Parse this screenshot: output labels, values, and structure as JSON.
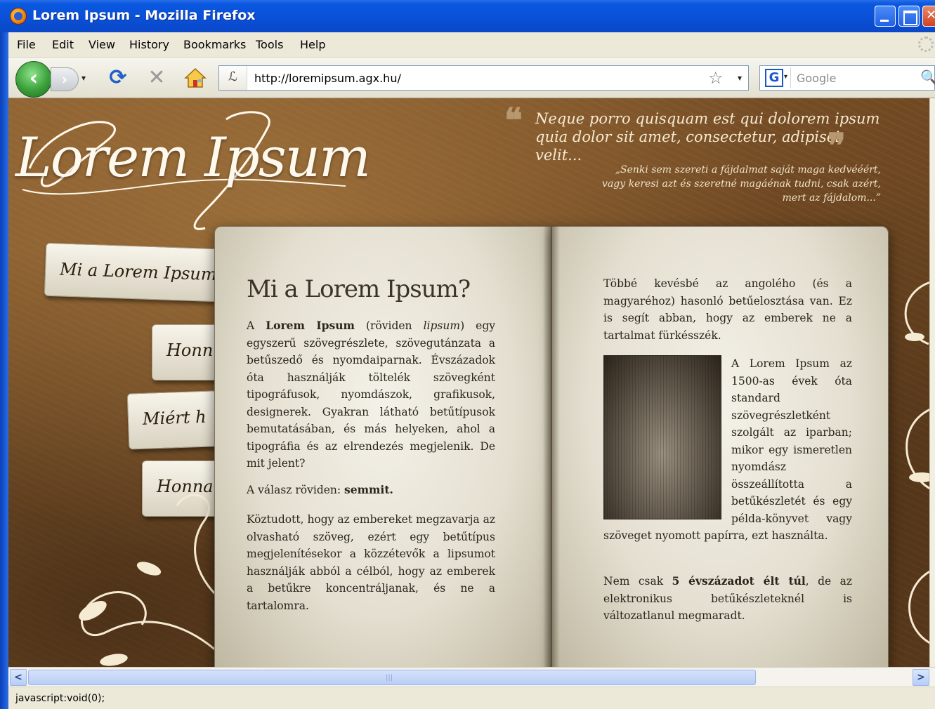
{
  "window": {
    "title": "Lorem Ipsum - Mozilla Firefox"
  },
  "menu": [
    "File",
    "Edit",
    "View",
    "History",
    "Bookmarks",
    "Tools",
    "Help"
  ],
  "nav": {
    "back_glyph": "‹",
    "forward_glyph": "›",
    "dropdown_glyph": "▾",
    "reload_glyph": "⟳",
    "stop_glyph": "✕",
    "home_icon": "home-icon"
  },
  "url": {
    "icon_glyph": "ℒ",
    "value": "http://loremipsum.agx.hu/",
    "star_glyph": "☆",
    "dropdown_glyph": "▾"
  },
  "search": {
    "engine_glyph": "G",
    "placeholder": "Google",
    "go_glyph": "🔍"
  },
  "page": {
    "logo": "Lorem Ipsum",
    "quote_main": "Neque porro quisquam est qui dolorem ipsum quia dolor sit amet, consectetur, adipisci velit...",
    "quote_open": "❝",
    "quote_close": "❞",
    "quote_sub": "„Senki sem szereti a fájdalmat saját maga kedvééért, vagy keresi azt és szeretné magáénak tudni, csak azért, mert az fájdalom...”",
    "nav_items": [
      "Mi a Lorem Ipsum",
      "Honn",
      "Miért h",
      "Honna"
    ],
    "left": {
      "title": "Mi a Lorem Ipsum?",
      "p1_a": "A ",
      "p1_bold": "Lorem Ipsum",
      "p1_b": " (röviden ",
      "p1_italic": "lipsum",
      "p1_c": ") egy egyszerű szövegrészlete, szövegutánzata a betűszedő és nyomdaiparnak. Évszázadok óta használják töltelék szövegként tipográfusok, nyomdászok, grafikusok, designerek. Gyakran látható betűtípusok bemutatásában, és más helyeken, ahol a tipográfia és az elrendezés megjelenik. De mit jelent?",
      "p2_a": "A válasz röviden: ",
      "p2_bold": "semmit.",
      "p3": "Köztudott, hogy az embereket megzavarja az olvasható szöveg, ezért egy betűtípus megjelenítésekor a közzétevők a lipsumot használják abból a célból, hogy az emberek a betűkre koncentráljanak, és ne a tartalomra."
    },
    "right": {
      "p1": "Többé kevésbé az angolého (és a magyaréhoz) hasonló betűelosztása van. Ez is segít abban, hogy az emberek ne a tartalmat fürkésszék.",
      "p2": "A Lorem Ipsum az 1500-as évek óta standard szövegrészletként szolgált az iparban; mikor egy ismeretlen nyomdász összeállította a betűkészletét és egy példa-könyvet vagy szöveget nyomott papírra, ezt használta.",
      "p3_a": "Nem csak ",
      "p3_bold": "5 évszázadot élt túl",
      "p3_b": ", de az elektronikus betűkészleteknél is változatlanul megmaradt."
    }
  },
  "scrollbar": {
    "left_glyph": "<",
    "right_glyph": ">",
    "grip": "|||"
  },
  "status": "javascript:void(0);"
}
